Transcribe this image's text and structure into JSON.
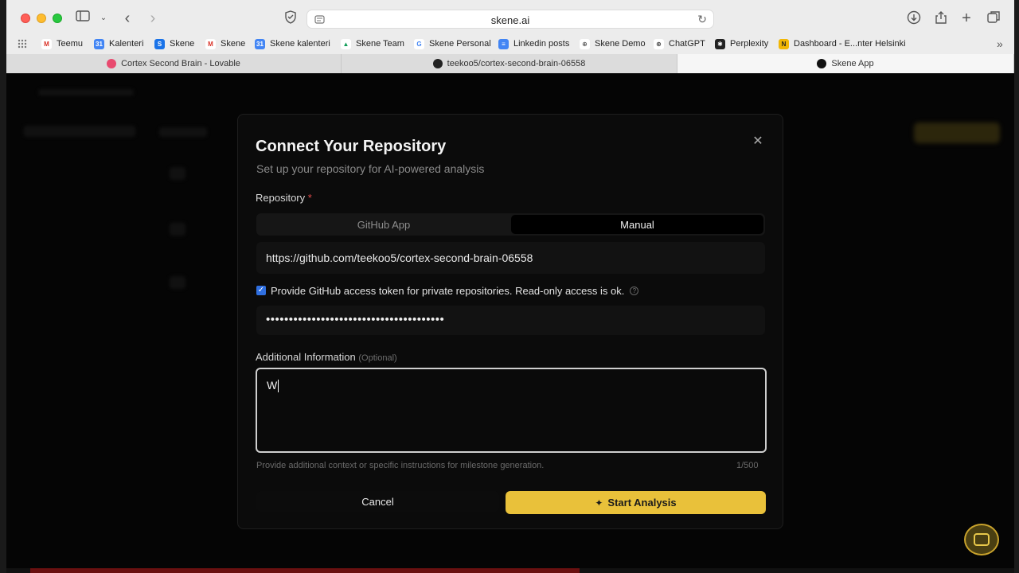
{
  "browser": {
    "url": "skene.ai",
    "bookmarks": [
      {
        "label": "Teemu",
        "color": "#d93025",
        "glyph": "M"
      },
      {
        "label": "Kalenteri",
        "color": "#4285f4",
        "glyph": "31"
      },
      {
        "label": "Skene",
        "color": "#1a73e8",
        "glyph": "S"
      },
      {
        "label": "Skene",
        "color": "#d93025",
        "glyph": "M"
      },
      {
        "label": "Skene kalenteri",
        "color": "#4285f4",
        "glyph": "31"
      },
      {
        "label": "Skene Team",
        "color": "#0f9d58",
        "glyph": "▲"
      },
      {
        "label": "Skene Personal",
        "color": "#ffffff",
        "glyph": "G"
      },
      {
        "label": "Linkedin posts",
        "color": "#4285f4",
        "glyph": "≡"
      },
      {
        "label": "Skene Demo",
        "color": "#888888",
        "glyph": "⊕"
      },
      {
        "label": "ChatGPT",
        "color": "#444444",
        "glyph": "⊛"
      },
      {
        "label": "Perplexity",
        "color": "#222222",
        "glyph": "✱"
      },
      {
        "label": "Dashboard - E...nter Helsinki",
        "color": "#f2b705",
        "glyph": "N"
      }
    ],
    "tabs": [
      {
        "label": "Cortex Second Brain - Lovable",
        "color": "#e84a6f",
        "active": false
      },
      {
        "label": "teekoo5/cortex-second-brain-06558",
        "color": "#222222",
        "active": false
      },
      {
        "label": "Skene App",
        "color": "#111111",
        "active": true
      }
    ]
  },
  "modal": {
    "title": "Connect Your Repository",
    "subtitle": "Set up your repository for AI-powered analysis",
    "repository_label": "Repository",
    "required_mark": "*",
    "segments": {
      "github_app": "GitHub App",
      "manual": "Manual",
      "selected": "Manual"
    },
    "repo_url": "https://github.com/teekoo5/cortex-second-brain-06558",
    "token_checkbox": {
      "checked": true,
      "label": "Provide GitHub access token for private repositories. Read-only access is ok."
    },
    "token_value": "•••••••••••••••••••••••••••••••••••••••",
    "additional_label": "Additional Information",
    "optional_label": "(Optional)",
    "additional_value": "W",
    "hint": "Provide additional context or specific instructions for milestone generation.",
    "counter": "1/500",
    "cancel_label": "Cancel",
    "start_label": "Start Analysis"
  },
  "colors": {
    "accent": "#e9c13a",
    "checkbox": "#2f6fe0",
    "required": "#e04a4a"
  }
}
